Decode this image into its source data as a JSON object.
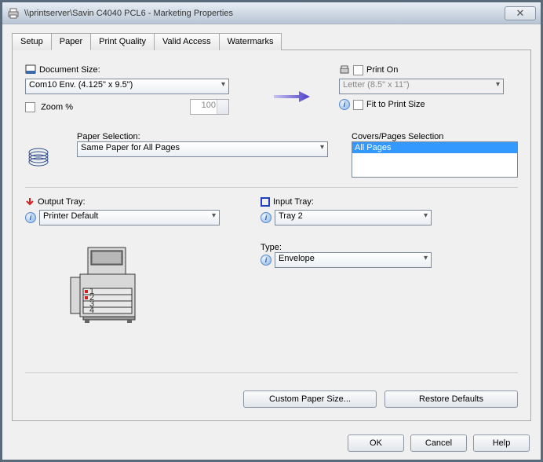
{
  "window": {
    "title": "\\\\printserver\\Savin C4040 PCL6 - Marketing Properties"
  },
  "tabs": [
    "Setup",
    "Paper",
    "Print Quality",
    "Valid Access",
    "Watermarks"
  ],
  "activeTab": "Paper",
  "paper": {
    "documentSizeLabel": "Document Size:",
    "documentSizeValue": "Com10 Env. (4.125\" x 9.5\")",
    "zoomLabel": "Zoom %",
    "zoomValue": "100",
    "printOnLabel": "Print On",
    "printOnValue": "Letter (8.5\" x 11\")",
    "fitLabel": "Fit to Print Size",
    "paperSelectionLabel": "Paper Selection:",
    "paperSelectionValue": "Same Paper for All Pages",
    "coversLabel": "Covers/Pages Selection",
    "coversItems": [
      "All Pages"
    ],
    "outputTrayLabel": "Output Tray:",
    "outputTrayValue": "Printer Default",
    "inputTrayLabel": "Input Tray:",
    "inputTrayValue": "Tray 2",
    "typeLabel": "Type:",
    "typeValue": "Envelope"
  },
  "buttons": {
    "customPaper": "Custom Paper Size...",
    "restore": "Restore Defaults",
    "ok": "OK",
    "cancel": "Cancel",
    "help": "Help"
  }
}
